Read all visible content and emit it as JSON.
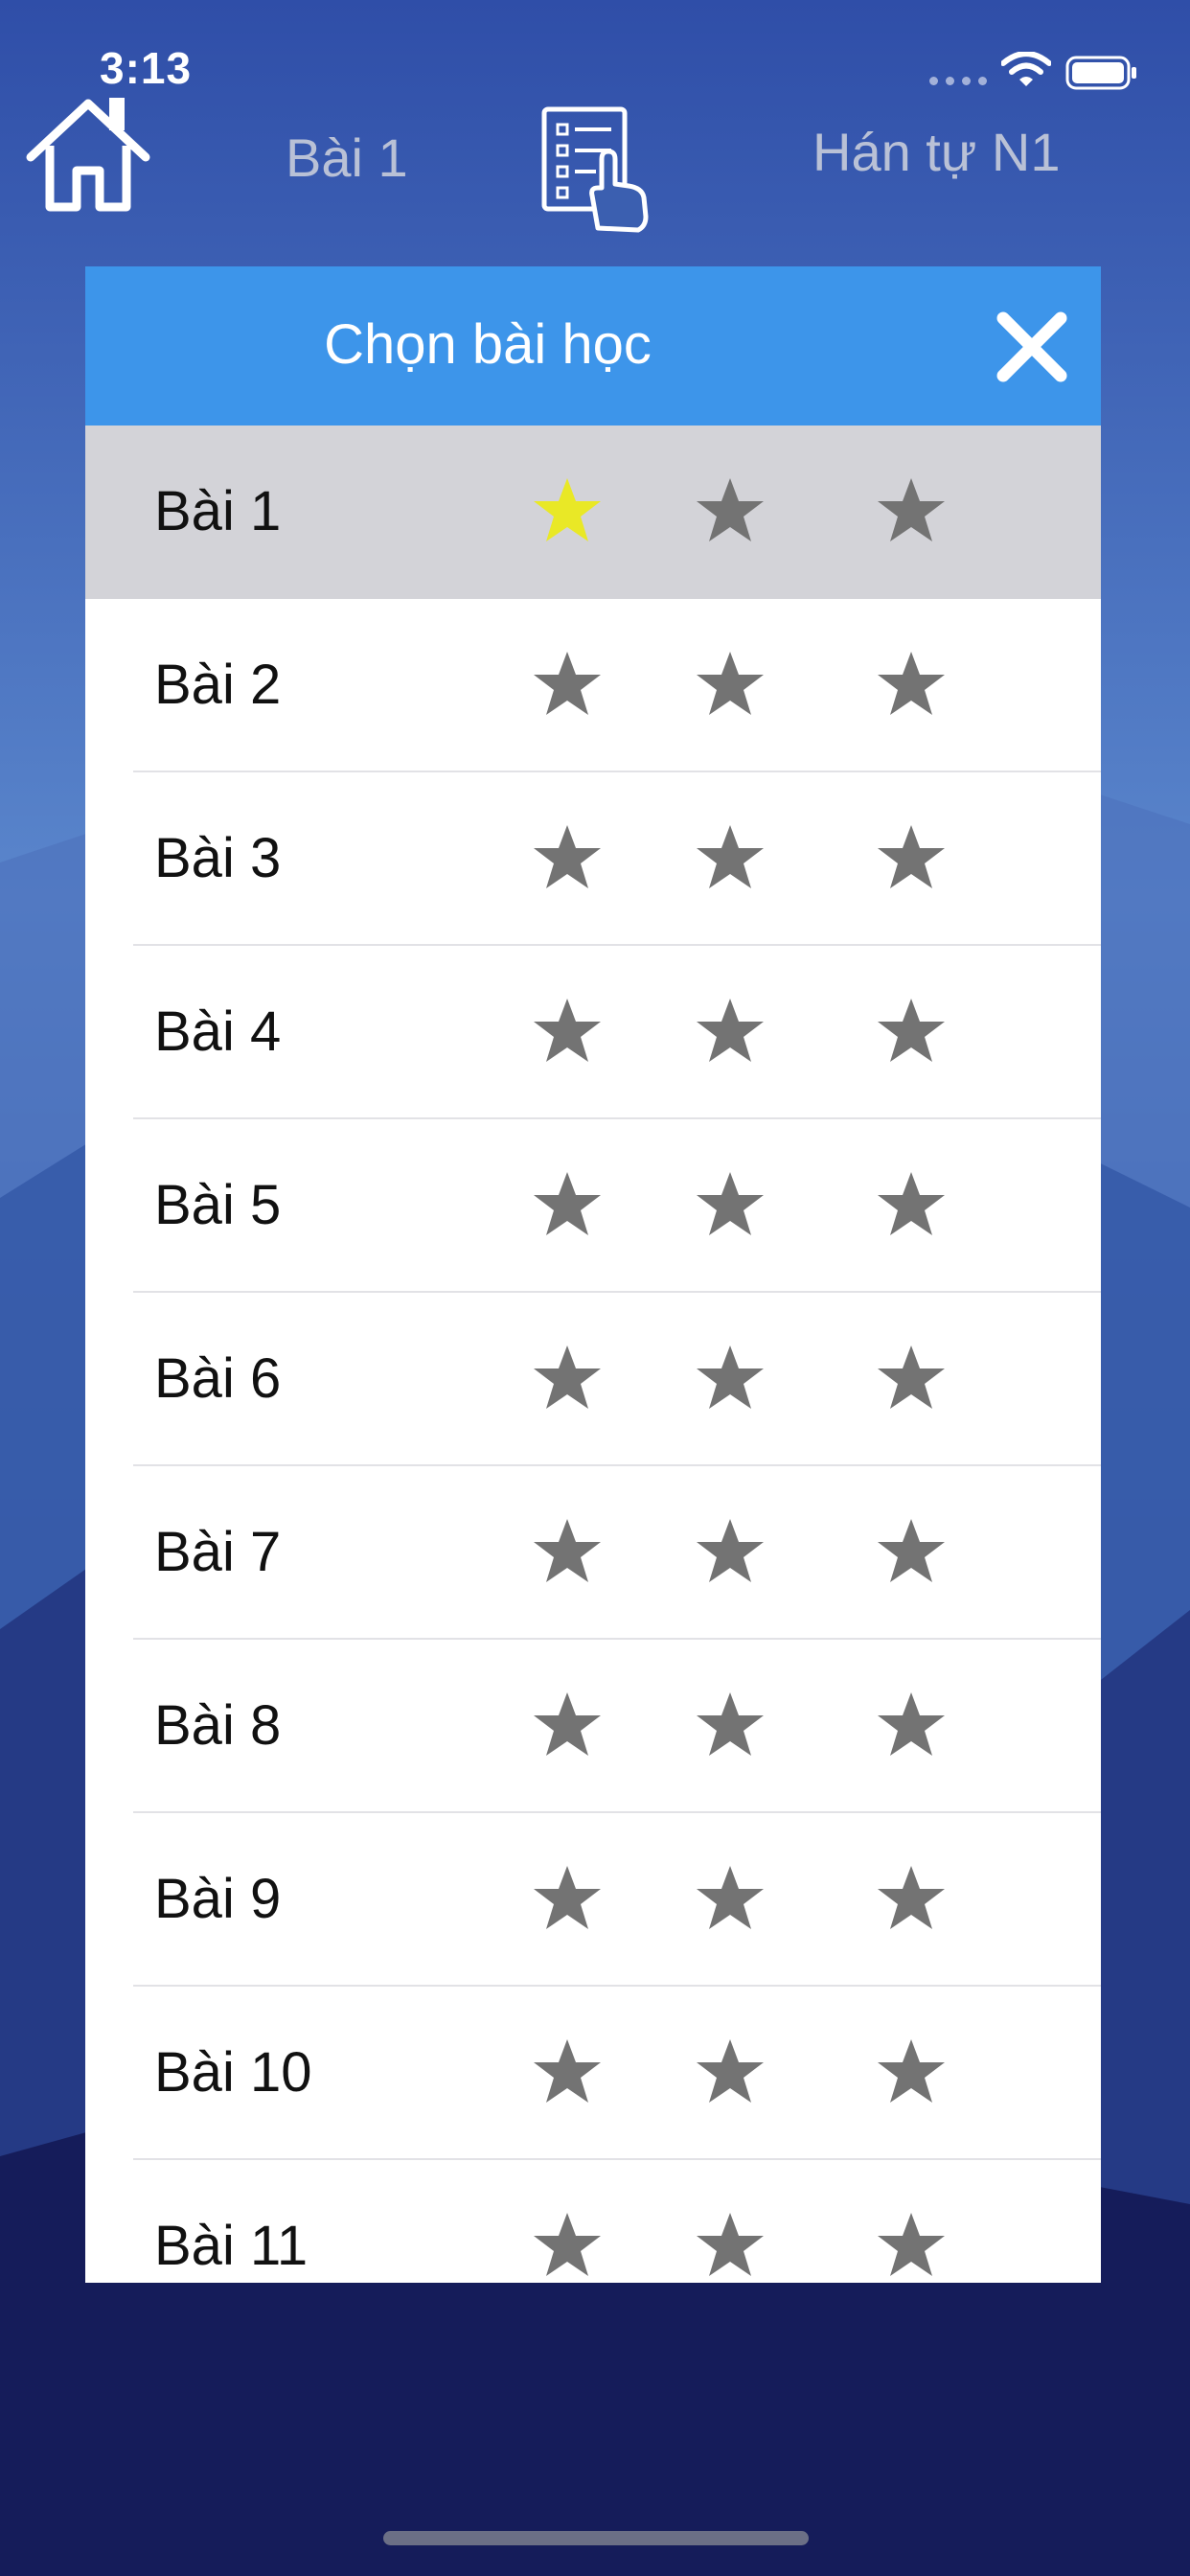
{
  "status_bar": {
    "time": "3:13"
  },
  "nav": {
    "lesson": "Bài 1",
    "course": "Hán tự N1"
  },
  "modal": {
    "title": "Chọn bài học",
    "lessons": [
      {
        "label": "Bài 1",
        "stars": 1
      },
      {
        "label": "Bài 2",
        "stars": 0
      },
      {
        "label": "Bài 3",
        "stars": 0
      },
      {
        "label": "Bài 4",
        "stars": 0
      },
      {
        "label": "Bài 5",
        "stars": 0
      },
      {
        "label": "Bài 6",
        "stars": 0
      },
      {
        "label": "Bài 7",
        "stars": 0
      },
      {
        "label": "Bài 8",
        "stars": 0
      },
      {
        "label": "Bài 9",
        "stars": 0
      },
      {
        "label": "Bài 10",
        "stars": 0
      },
      {
        "label": "Bài 11",
        "stars": 0
      }
    ],
    "selected_lesson": "Bài 1"
  },
  "colors": {
    "header": "#3d95ea",
    "star_earned": "#e9e826",
    "star_empty": "#737373",
    "selected_row": "#d3d3d8"
  },
  "icons": {
    "home": "home-icon",
    "lesson_list": "checklist-hand-icon",
    "close": "close-icon",
    "star": "star-icon"
  }
}
